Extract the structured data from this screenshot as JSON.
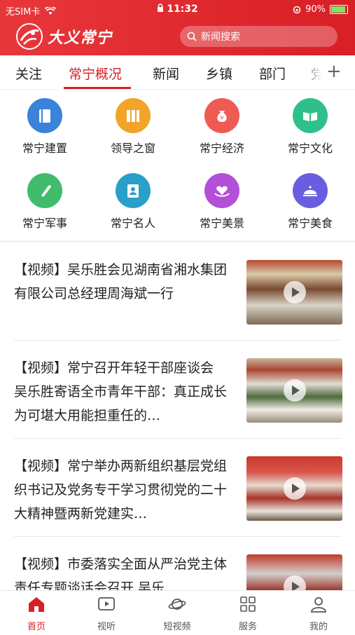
{
  "status": {
    "carrier": "无SIM卡",
    "time": "11:32",
    "battery": "90%",
    "battery_level": 0.9
  },
  "header": {
    "logo_text": "大义常宁",
    "search_placeholder": "新闻搜索"
  },
  "tabs": [
    {
      "label": "关注"
    },
    {
      "label": "常宁概况"
    },
    {
      "label": "新闻"
    },
    {
      "label": "乡镇"
    },
    {
      "label": "部门"
    },
    {
      "label": "党"
    }
  ],
  "grid": [
    {
      "label": "常宁建置",
      "icon": "book-icon",
      "color": "#3b82d9"
    },
    {
      "label": "领导之窗",
      "icon": "books-icon",
      "color": "#f2a32a"
    },
    {
      "label": "常宁经济",
      "icon": "money-bag-icon",
      "color": "#ef5b52"
    },
    {
      "label": "常宁文化",
      "icon": "open-book-icon",
      "color": "#2fbf8b"
    },
    {
      "label": "常宁军事",
      "icon": "bullet-icon",
      "color": "#3fbd6c"
    },
    {
      "label": "常宁名人",
      "icon": "person-card-icon",
      "color": "#2a9fc8"
    },
    {
      "label": "常宁美景",
      "icon": "heart-hands-icon",
      "color": "#b34fd8"
    },
    {
      "label": "常宁美食",
      "icon": "cloche-icon",
      "color": "#6a5ee0"
    }
  ],
  "news": [
    {
      "title": "【视频】吴乐胜会见湖南省湘水集团有限公司总经理周海斌一行"
    },
    {
      "title": "【视频】常宁召开年轻干部座谈会 吴乐胜寄语全市青年干部：真正成长为可堪大用能担重任的…"
    },
    {
      "title": "【视频】常宁举办两新组织基层党组织书记及党务专干学习贯彻党的二十大精神暨两新党建实…"
    },
    {
      "title": "【视频】市委落实全面从严治党主体责任专题谈话会召开 吴乐…"
    }
  ],
  "bottom_nav": [
    {
      "label": "首页",
      "icon": "home-icon"
    },
    {
      "label": "视听",
      "icon": "play-screen-icon"
    },
    {
      "label": "短视频",
      "icon": "planet-icon"
    },
    {
      "label": "服务",
      "icon": "grid-icon"
    },
    {
      "label": "我的",
      "icon": "user-icon"
    }
  ]
}
